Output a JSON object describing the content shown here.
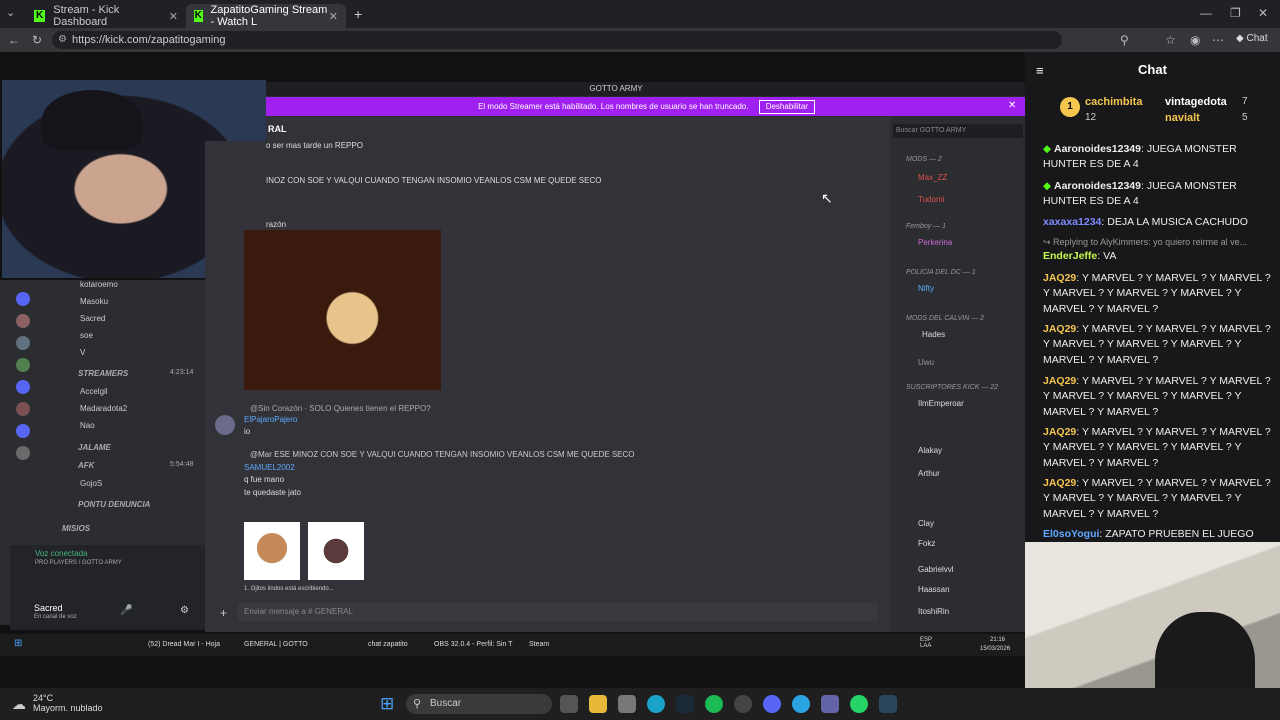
{
  "browser": {
    "tabs": [
      {
        "label": "Stream - Kick Dashboard"
      },
      {
        "label": "ZapatitoGaming Stream - Watch L"
      }
    ],
    "url": "https://kick.com/zapatitogaming"
  },
  "discord": {
    "window_title": "GOTTO ARMY",
    "banner_text": "El modo Streamer está habilitado. Los nombres de usuario se han truncado.",
    "banner_button": "Deshabilitar",
    "channel": "RAL",
    "search_placeholder": "Buscar GOTTO ARMY",
    "messages": [
      "o ser mas tarde un REPPO",
      "INOZ CON SOE Y VALQUI CUANDO TENGAN INSOMIO VEANLOS CSM ME QUEDE SECO",
      "razón",
      "@Sin Corazón · SOLO Quienes tienen el REPPO?",
      "ElPajaroPajero",
      "io",
      "@Mar ESE MINOZ CON SOE Y VALQUI CUANDO TENGAN INSOMIO VEANLOS CSM ME QUEDE SECO",
      "SAMUEL2002",
      "q fue mano",
      "te quedaste jato"
    ],
    "typing": "1. Ojitos lindos está escribiendo...",
    "input_placeholder": "Enviar mensaje a # GENERAL",
    "voice": {
      "status": "Voz conectada",
      "sub": "PRO PLAYERS / GOTTO ARMY",
      "user": "Sacred",
      "user_status": "En canal de voz"
    },
    "left_items": [
      "kotaroemo",
      "Masoku",
      "Sacred",
      "soe",
      "V",
      "STREAMERS",
      "Accelgil",
      "Madaradota2",
      "Nao",
      "JALAME",
      "AFK",
      "GojoS",
      "PONTU DENUNCIA",
      "MISIOS"
    ],
    "left_time": [
      "4:23:14",
      "5:54:48"
    ],
    "members": [
      {
        "cat": "MODS — 2"
      },
      {
        "name": "Max_ZZ"
      },
      {
        "name": "Tudomi"
      },
      {
        "cat": "Femboy — 1"
      },
      {
        "name": "Perkerina"
      },
      {
        "cat": "POLICIA DEL DC — 1"
      },
      {
        "name": "Nifty"
      },
      {
        "cat": "MODS DEL CALVIN — 2"
      },
      {
        "name": "Hades"
      },
      {
        "name": "Uwu"
      },
      {
        "cat": "SUSCRIPTORES KICK — 22"
      },
      {
        "name": "IlmEmperoar"
      },
      {
        "name": "Alakay"
      },
      {
        "name": "Arthur"
      },
      {
        "name": "Clay"
      },
      {
        "name": "Fokz"
      },
      {
        "name": "Gabrielvvl"
      },
      {
        "name": "Haassan"
      },
      {
        "name": "ItoshiRin"
      }
    ],
    "taskbar_items": [
      "(52) Dread Mar I - Hoja",
      "GENERAL | GOTTO",
      "chat zapatito",
      "OBS 32.0.4 - Perfil: Sin T",
      "Steam"
    ],
    "taskbar_tray": {
      "lang": "ESP LAA",
      "time": "21:16",
      "date": "15/03/2026"
    }
  },
  "chat": {
    "title": "Chat",
    "gifters": [
      {
        "rank": "1",
        "name": "cachimbita",
        "count": "12",
        "color": "#f5c64e"
      },
      {
        "name": "vintagedota",
        "count": "7",
        "color": "#ffffff"
      },
      {
        "name": "navialt",
        "count": "5",
        "color": "#f5c64e"
      }
    ],
    "messages": [
      {
        "user": "Aaronoides12349",
        "text": "JUEGA MONSTER HUNTER ES DE A 4",
        "color": "#ffffff"
      },
      {
        "user": "Aaronoides12349",
        "text": "JUEGA MONSTER HUNTER ES DE A 4",
        "color": "#ffffff"
      },
      {
        "user": "xaxaxa1234",
        "text": "DEJA LA MUSICA CACHUDO",
        "color": "#7f8cff"
      },
      {
        "reply": "Replying to AlyKimmers: yo quiero reirme al ve..."
      },
      {
        "user": "EnderJeffe",
        "text": "VA",
        "color": "#c6f64e"
      },
      {
        "user": "JAQ29",
        "text": "Y MARVEL ? Y MARVEL ? Y MARVEL ? Y MARVEL ? Y MARVEL ? Y MARVEL ? Y MARVEL ? Y MARVEL ?",
        "color": "#f5c64e"
      },
      {
        "user": "JAQ29",
        "text": "Y MARVEL ? Y MARVEL ? Y MARVEL ? Y MARVEL ? Y MARVEL ? Y MARVEL ? Y MARVEL ? Y MARVEL ?",
        "color": "#f5c64e"
      },
      {
        "user": "JAQ29",
        "text": "Y MARVEL ? Y MARVEL ? Y MARVEL ? Y MARVEL ? Y MARVEL ? Y MARVEL ? Y MARVEL ? Y MARVEL ?",
        "color": "#f5c64e"
      },
      {
        "user": "JAQ29",
        "text": "Y MARVEL ? Y MARVEL ? Y MARVEL ? Y MARVEL ? Y MARVEL ? Y MARVEL ? Y MARVEL ? Y MARVEL ?",
        "color": "#f5c64e"
      },
      {
        "user": "JAQ29",
        "text": "Y MARVEL ? Y MARVEL ? Y MARVEL ? Y MARVEL ? Y MARVEL ? Y MARVEL ? Y MARVEL ? Y MARVEL ?",
        "color": "#f5c64e"
      },
      {
        "user": "El0soYogui",
        "text": "ZAPATO PRUEBEN EL JUEGO",
        "color": "#5fa8ff"
      }
    ]
  },
  "windows": {
    "weather_temp": "24°C",
    "weather_desc": "Mayorm. nublado",
    "search_placeholder": "Buscar"
  },
  "colors": {
    "kick_green": "#53fc18",
    "discord_banner": "#a020f0"
  }
}
